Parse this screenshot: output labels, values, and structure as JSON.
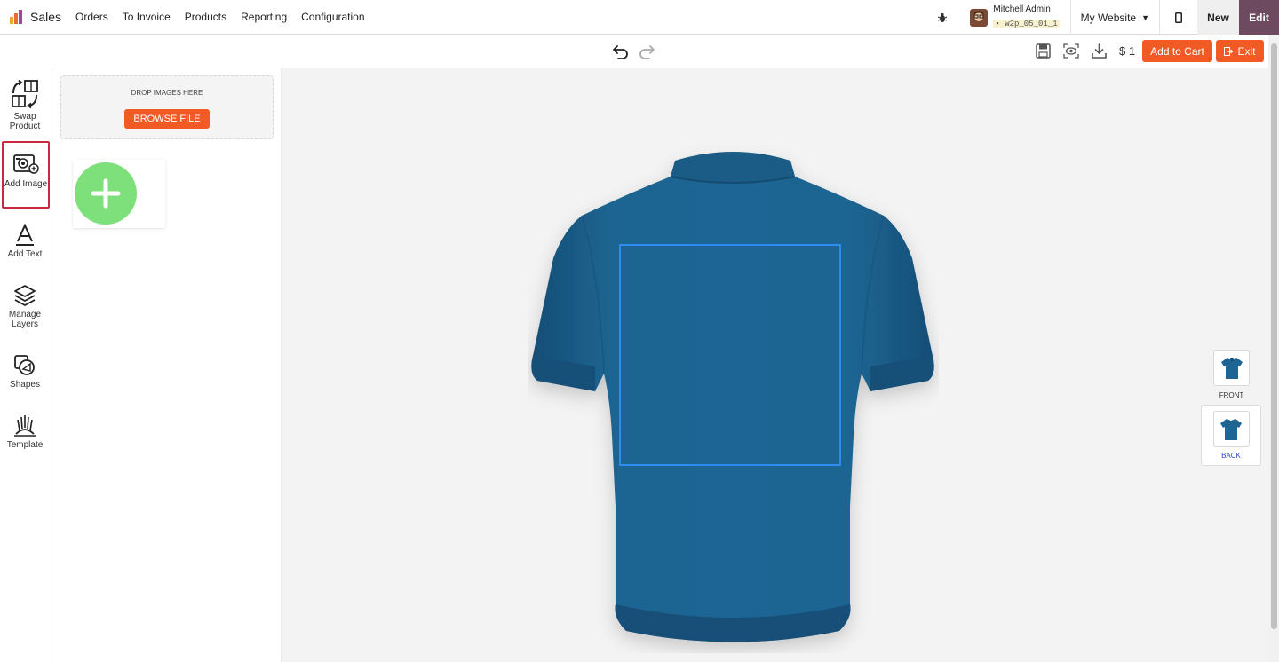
{
  "nav": {
    "app_name": "Sales",
    "menu": [
      "Orders",
      "To Invoice",
      "Products",
      "Reporting",
      "Configuration"
    ],
    "user_name": "Mitchell Admin",
    "db_name": "w2p_05_01_1",
    "website": "My Website",
    "new_label": "New",
    "edit_label": "Edit"
  },
  "toolbar": {
    "price": "$ 1",
    "add_to_cart": "Add to Cart",
    "exit": "Exit"
  },
  "sidebar": {
    "items": [
      {
        "label": "Swap Product",
        "icon": "swap-product-icon"
      },
      {
        "label": "Add Image",
        "icon": "add-image-icon",
        "active": true
      },
      {
        "label": "Add Text",
        "icon": "text-icon"
      },
      {
        "label": "Manage Layers",
        "icon": "layers-icon"
      },
      {
        "label": "Shapes",
        "icon": "shapes-icon"
      },
      {
        "label": "Template",
        "icon": "template-icon"
      }
    ]
  },
  "panel": {
    "drop_text": "DROP IMAGES HERE",
    "browse_label": "BROWSE FILE"
  },
  "views": {
    "front": "FRONT",
    "back": "BACK",
    "active": "BACK"
  },
  "colors": {
    "accent": "#f15a24",
    "edit": "#6e4a61",
    "shirt": "#1e6594",
    "print_area": "#2e8cf0",
    "add_circle": "#7ee07a",
    "active_outline": "#c9283f"
  }
}
